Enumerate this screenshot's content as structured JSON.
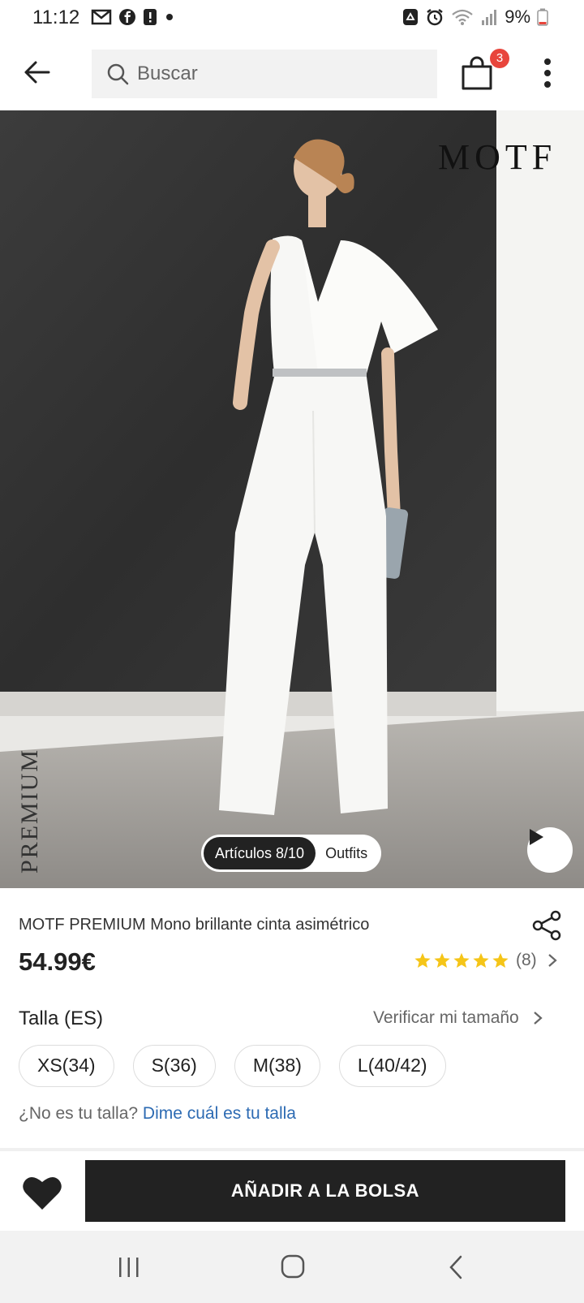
{
  "status_bar": {
    "time": "11:12",
    "battery": "9%"
  },
  "header": {
    "search_placeholder": "Buscar",
    "cart_count": "3"
  },
  "hero": {
    "brand_logo": "MOTF",
    "vertical_text": "PREMIUM",
    "articles_label": "Artículos 8/10",
    "outfits_label": "Outfits"
  },
  "product": {
    "title": "MOTF PREMIUM Mono brillante cinta asimétrico",
    "price": "54.99€",
    "rating_stars": 5,
    "rating_count": "(8)",
    "size_label": "Talla (ES)",
    "verify_size": "Verificar mi tamaño",
    "sizes": [
      "XS(34)",
      "S(36)",
      "M(38)",
      "L(40/42)"
    ],
    "size_hint_prefix": "¿No es tu talla? ",
    "size_hint_link": "Dime cuál es tu talla"
  },
  "footer": {
    "add_to_bag": "AÑADIR A LA BOLSA"
  },
  "colors": {
    "accent_dark": "#222222",
    "badge_red": "#e8453c",
    "star_yellow": "#f5c518",
    "link_blue": "#2d6bb3"
  },
  "icons": [
    "back-arrow-icon",
    "search-icon",
    "shopping-bag-icon",
    "more-vertical-icon",
    "play-icon",
    "share-icon",
    "star-icon",
    "chevron-right-icon",
    "heart-icon",
    "nav-recent-icon",
    "nav-home-icon",
    "nav-back-icon"
  ]
}
